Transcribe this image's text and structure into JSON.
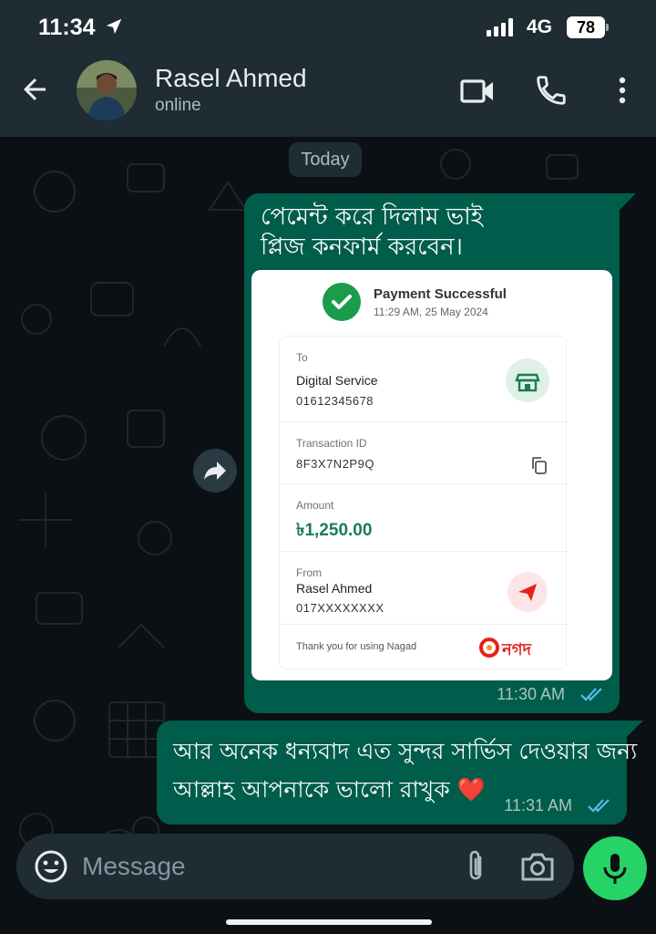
{
  "status_bar": {
    "time": "11:34",
    "network": "4G",
    "battery": "78"
  },
  "header": {
    "contact_name": "Rasel Ahmed",
    "presence": "online"
  },
  "chat": {
    "date_chip": "Today",
    "messages": [
      {
        "lines": [
          "পেমেন্ট করে দিলাম ভাই",
          "প্লিজ কনফার্ম করবেন।"
        ],
        "time": "11:30 AM",
        "status": "read"
      },
      {
        "lines": [
          "আর অনেক ধন্যবাদ এত সুন্দর সার্ভিস দেওয়ার জন্য",
          "আল্লাহ আপনাকে ভালো রাখুক ❤️"
        ],
        "time": "11:31 AM",
        "status": "read"
      }
    ]
  },
  "receipt": {
    "status": "Payment Successful",
    "datetime": "11:29 AM, 25 May 2024",
    "to_label": "To",
    "to_name": "Digital Service",
    "to_number": "01612345678",
    "txn_label": "Transaction ID",
    "txn_id": "8F3X7N2P9Q",
    "amount_label": "Amount",
    "amount": "৳1,250.00",
    "from_label": "From",
    "from_name": "Rasel Ahmed",
    "from_number": "017XXXXXXXX",
    "thanks": "Thank you for using Nagad",
    "brand": "নগদ"
  },
  "composer": {
    "placeholder": "Message"
  },
  "colors": {
    "header_bg": "#1f2c34",
    "chat_bg": "#0b1014",
    "outgoing_bubble": "#005c4b",
    "accent_green": "#25d366",
    "read_ticks": "#53bdeb",
    "nagad_red": "#e2231a"
  },
  "icons": [
    "location-arrow-icon",
    "signal-icon",
    "battery-icon",
    "back-arrow-icon",
    "video-call-icon",
    "phone-icon",
    "more-vert-icon",
    "forward-icon",
    "double-check-icon",
    "check-circle-icon",
    "store-icon",
    "copy-icon",
    "send-plane-icon",
    "nagad-logo",
    "emoji-icon",
    "attach-icon",
    "camera-icon",
    "mic-icon"
  ]
}
